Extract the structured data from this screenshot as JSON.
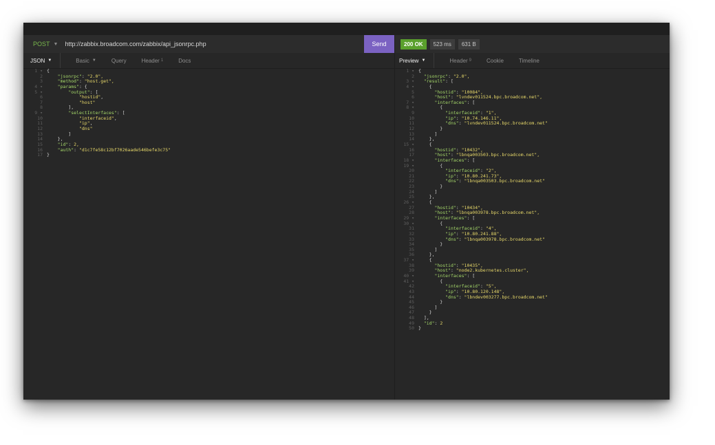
{
  "request": {
    "method": "POST",
    "url": "http://zabbix.broadcom.com/zabbix/api_jsonrpc.php",
    "send_label": "Send"
  },
  "response_status": {
    "code": "200 OK",
    "time": "523 ms",
    "size": "631 B"
  },
  "request_tabs": {
    "json": "JSON",
    "basic": "Basic",
    "query": "Query",
    "header": "Header",
    "header_count": "1",
    "docs": "Docs"
  },
  "response_tabs": {
    "preview": "Preview",
    "header": "Header",
    "header_count": "9",
    "cookie": "Cookie",
    "timeline": "Timeline"
  },
  "request_body": [
    "{",
    "    \"jsonrpc\": \"2.0\",",
    "    \"method\": \"host.get\",",
    "    \"params\": {",
    "        \"output\": [",
    "            \"hostid\",",
    "            \"host\"",
    "        ],",
    "        \"selectInterfaces\": [",
    "            \"interfaceid\",",
    "            \"ip\",",
    "            \"dns\"",
    "        ]",
    "    },",
    "    \"id\": 2,",
    "    \"auth\": \"d1c7fe58c12bf7026aade546befe3c75\"",
    "}"
  ],
  "response_body": [
    "{",
    "  \"jsonrpc\": \"2.0\",",
    "  \"result\": [",
    "    {",
    "      \"hostid\": \"10084\",",
    "      \"host\": \"lvndev011524.bpc.broadcom.net\",",
    "      \"interfaces\": [",
    "        {",
    "          \"interfaceid\": \"1\",",
    "          \"ip\": \"10.74.146.11\",",
    "          \"dns\": \"lvndev011524.bpc.broadcom.net\"",
    "        }",
    "      ]",
    "    },",
    "    {",
    "      \"hostid\": \"10432\",",
    "      \"host\": \"lbnqa003503.bpc.broadcom.net\",",
    "      \"interfaces\": [",
    "        {",
    "          \"interfaceid\": \"2\",",
    "          \"ip\": \"10.80.241.73\",",
    "          \"dns\": \"lbnqa003503.bpc.broadcom.net\"",
    "        }",
    "      ]",
    "    },",
    "    {",
    "      \"hostid\": \"10434\",",
    "      \"host\": \"lbnqa003978.bpc.broadcom.net\",",
    "      \"interfaces\": [",
    "        {",
    "          \"interfaceid\": \"4\",",
    "          \"ip\": \"10.80.241.88\",",
    "          \"dns\": \"lbnqa003978.bpc.broadcom.net\"",
    "        }",
    "      ]",
    "    },",
    "    {",
    "      \"hostid\": \"10435\",",
    "      \"host\": \"node2.kubernetes.cluster\",",
    "      \"interfaces\": [",
    "        {",
    "          \"interfaceid\": \"5\",",
    "          \"ip\": \"10.80.120.148\",",
    "          \"dns\": \"lbndev003277.bpc.broadcom.net\"",
    "        }",
    "      ]",
    "    }",
    "  ],",
    "  \"id\": 2",
    "}"
  ],
  "colors": {
    "accent": "#7b62c2",
    "status_ok": "#5aa02c",
    "method": "#79b84c",
    "json_key": "#a6d96a",
    "json_value": "#e8d96a"
  }
}
